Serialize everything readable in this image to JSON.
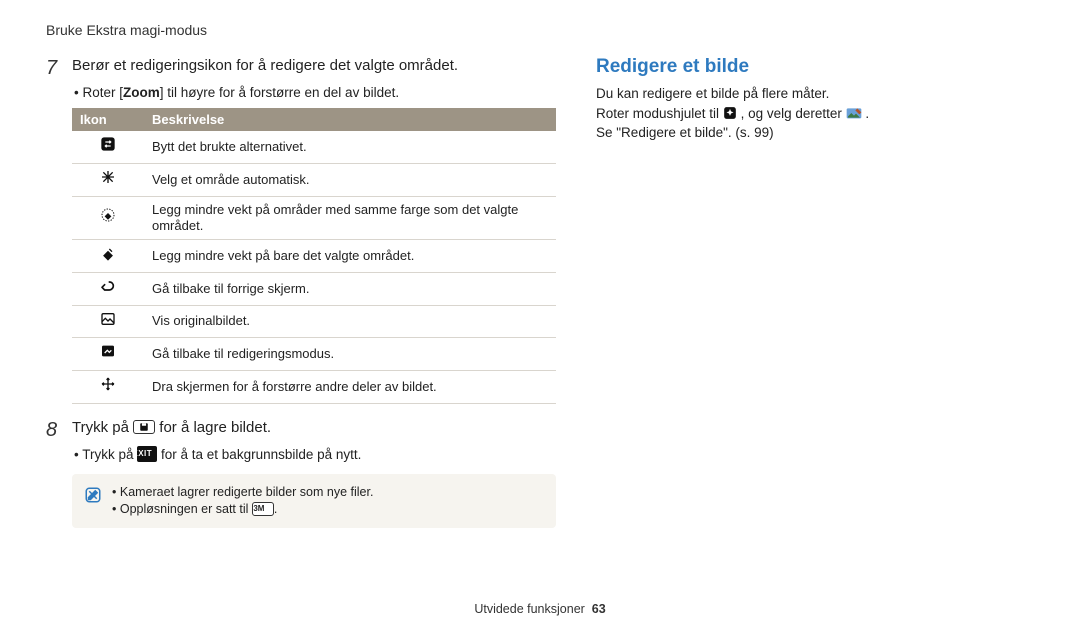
{
  "header": {
    "breadcrumb": "Bruke Ekstra magi-modus"
  },
  "left": {
    "step7": {
      "num": "7",
      "text": "Berør et redigeringsikon for å redigere det valgte området.",
      "bullet_pre": "Roter [",
      "bullet_bold": "Zoom",
      "bullet_post": "] til høyre for å forstørre en del av bildet."
    },
    "table": {
      "headers": {
        "icon": "Ikon",
        "desc": "Beskrivelse"
      },
      "rows": [
        {
          "icon_name": "swap-icon",
          "desc": "Bytt det brukte alternativet."
        },
        {
          "icon_name": "star-select-icon",
          "desc": "Velg et område automatisk."
        },
        {
          "icon_name": "eraser-less-color-icon",
          "desc": "Legg mindre vekt på områder med samme farge som det valgte området."
        },
        {
          "icon_name": "eraser-less-selected-icon",
          "desc": "Legg mindre vekt på bare det valgte området."
        },
        {
          "icon_name": "back-arrow-icon",
          "desc": "Gå tilbake til forrige skjerm."
        },
        {
          "icon_name": "original-image-icon",
          "desc": "Vis originalbildet."
        },
        {
          "icon_name": "edit-mode-icon",
          "desc": "Gå tilbake til redigeringsmodus."
        },
        {
          "icon_name": "pan-icon",
          "desc": "Dra skjermen for å forstørre andre deler av bildet."
        }
      ]
    },
    "step8": {
      "num": "8",
      "text_pre": "Trykk på ",
      "text_post": " for å lagre bildet.",
      "bullet_pre": "Trykk på ",
      "bullet_post": " for å ta et bakgrunnsbilde på nytt."
    },
    "note": {
      "line1": "Kameraet lagrer redigerte bilder som nye filer.",
      "line2_pre": "Oppløsningen er satt til ",
      "line2_post": "."
    }
  },
  "right": {
    "title": "Redigere et bilde",
    "line1": "Du kan redigere et bilde på flere måter.",
    "line2_pre": "Roter modushjulet til ",
    "line2_mid": ", og velg deretter ",
    "line2_post": ".",
    "line3": "Se \"Redigere et bilde\". (s. 99)"
  },
  "footer": {
    "label": "Utvidede funksjoner",
    "page": "63"
  }
}
